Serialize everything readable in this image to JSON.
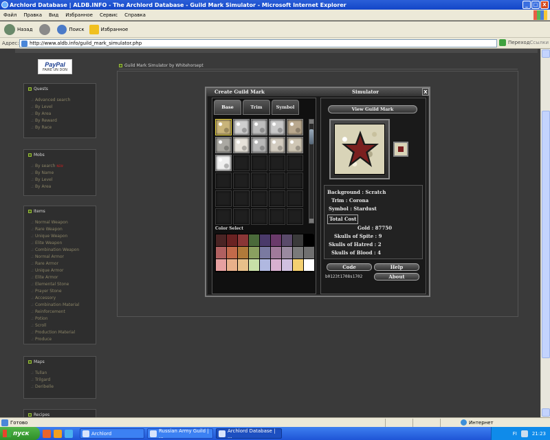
{
  "window": {
    "title": "Archlord Database | ALDB.INFO - The Archlord Database - Guild Mark Simulator - Microsoft Internet Explorer",
    "buttons": [
      "_",
      "□",
      "X"
    ]
  },
  "menu": [
    "Файл",
    "Правка",
    "Вид",
    "Избранное",
    "Сервис",
    "Справка"
  ],
  "toolbar": {
    "back": "Назад",
    "search": "Поиск",
    "favorites": "Избранное"
  },
  "address": {
    "label": "Адрес:",
    "url": "http://www.aldb.info/guild_mark_simulator.php",
    "go": "Переход",
    "links": "Ссылки"
  },
  "paypal": {
    "brand": "PayPal",
    "sub": "FAIRE UN DON"
  },
  "sidebar": {
    "quests": {
      "title": "Quests",
      "items": [
        "Advanced search",
        "By Level",
        "By Area",
        "By Reward",
        "By Race"
      ]
    },
    "mobs": {
      "title": "Mobs",
      "items": [
        "By search",
        "By Name",
        "By Level",
        "By Area"
      ],
      "new_badge": "NEW"
    },
    "items": {
      "title": "Items",
      "items": [
        "Normal Weapon",
        "Rare Weapon",
        "Unique Weapon",
        "Elite Weapon",
        "Combination Weapon",
        "Normal Armor",
        "Rare Armor",
        "Unique Armor",
        "Elite Armor",
        "Elemental Stone",
        "Prayer Stone",
        "Accessory",
        "Combination Material",
        "Reinforcement",
        "Potion",
        "Scroll",
        "Production Material",
        "Produce"
      ]
    },
    "maps": {
      "title": "Maps",
      "items": [
        "Tullan",
        "Trilgard",
        "Deribelle"
      ]
    },
    "recipes": {
      "title": "Recipes"
    }
  },
  "main": {
    "title": "Guild Mark Simulator by Whitehorsept"
  },
  "simulator": {
    "title_left": "Create Guild Mark",
    "title_right": "Simulator",
    "close": "X",
    "tabs": [
      "Base",
      "Trim",
      "Symbol"
    ],
    "color_select": "Color Select",
    "view_button": "View Guild Mark",
    "background_label": "Background :",
    "background_value": "Scratch",
    "trim_label": "Trim :",
    "trim_value": "Corona",
    "symbol_label": "Symbol :",
    "symbol_value": "Stardust",
    "total_cost": "Total Cost",
    "gold_label": "Gold :",
    "gold_value": "87750",
    "spite_label": "Skulls of Spite :",
    "spite_value": "9",
    "hatred_label": "Skulls of Hatred :",
    "hatred_value": "2",
    "blood_label": "Skulls of Blood :",
    "blood_value": "4",
    "code_button": "Code",
    "help_button": "Help",
    "about_button": "About",
    "code_value": "b0123t1708s1702",
    "textures": [
      "#c9b47a",
      "#cfcfcf",
      "#bdbdbd",
      "#c8c8c8",
      "#b9a88e",
      "#aaa8a2",
      "#e6e2da",
      "#b8b8b8",
      "#d3ccc0",
      "#cfc6b4",
      "#f0f0f0"
    ],
    "colors": [
      "#4a2424",
      "#6a2222",
      "#8a3636",
      "#4a6a3a",
      "#4a3a6a",
      "#6a3a6a",
      "#5a4a6a",
      "#3a3a3a",
      "#000000",
      "#b06060",
      "#c26a4a",
      "#b07a3a",
      "#8aa060",
      "#7a7aa0",
      "#a07a9a",
      "#9a8aa0",
      "#7a7a7a",
      "#707070",
      "#e6a0a0",
      "#e8b08a",
      "#e8c08a",
      "#c8e0a8",
      "#b0b8e0",
      "#d8b0d0",
      "#d0c0e0",
      "#f4d070",
      "#ffffff"
    ]
  },
  "status": {
    "text": "Готово",
    "zone": "Интернет"
  },
  "taskbar": {
    "start": "пуск",
    "tasks": [
      "Archlord",
      "Russian Army Guild | ...",
      "Archlord Database | ..."
    ],
    "lang": "FI",
    "time": "21:23"
  }
}
